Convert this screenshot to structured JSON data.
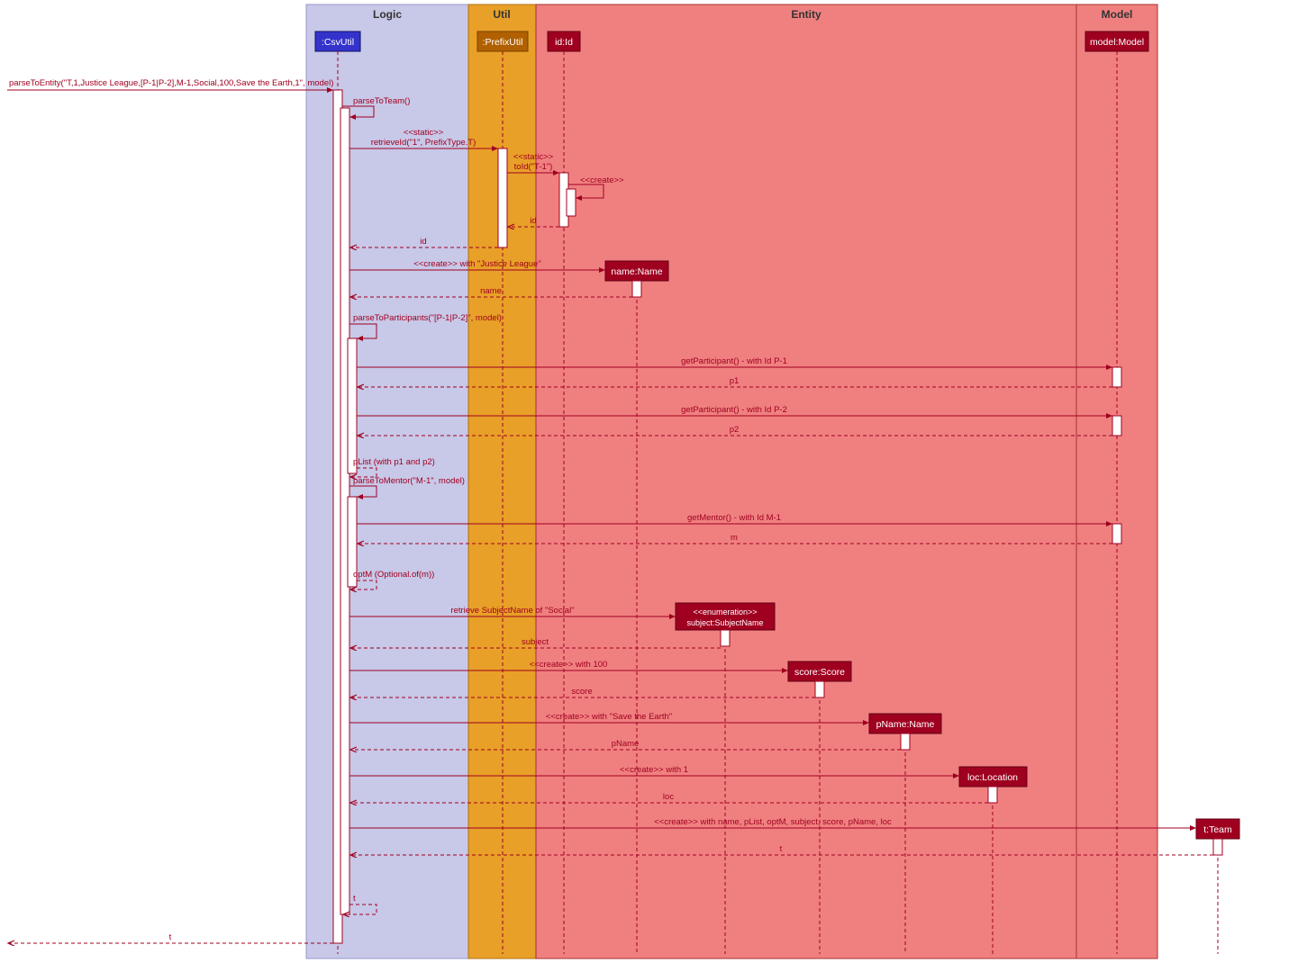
{
  "regions": {
    "logic": "Logic",
    "util": "Util",
    "entity": "Entity",
    "model": "Model"
  },
  "participants": {
    "csvutil": ":CsvUtil",
    "prefixutil": ":PrefixUtil",
    "id": "id:Id",
    "model": "model:Model",
    "name": "name:Name",
    "subject_stereo": "<<enumeration>>",
    "subject": "subject:SubjectName",
    "score": "score:Score",
    "pname": "pName:Name",
    "loc": "loc:Location",
    "team": "t:Team"
  },
  "messages": {
    "m0": "parseToEntity(\"T,1,Justice League,[P-1|P-2],M-1,Social,100,Save the Earth,1\", model)",
    "m1": "parseToTeam()",
    "m2a": "<<static>>",
    "m2b": "retrieveId(\"1\", PrefixType.T)",
    "m3a": "<<static>>",
    "m3b": "toId(\"T-1\")",
    "m4": "<<create>>",
    "m5": "id",
    "m6": "id",
    "m7": "<<create>> with \"Justice League\"",
    "m8": "name",
    "m9": "parseToParticipants(\"[P-1|P-2]\", model)",
    "m10": "getParticipant() - with Id P-1",
    "m11": "p1",
    "m12": "getParticipant() - with Id P-2",
    "m13": "p2",
    "m14": "pList (with p1 and p2)",
    "m15": "parseToMentor(\"M-1\", model)",
    "m16": "getMentor() - with Id M-1",
    "m17": "m",
    "m18": "optM (Optional.of(m))",
    "m19": "retrieve SubjectName of \"Social\"",
    "m20": "subject",
    "m21": "<<create>> with 100",
    "m22": "score",
    "m23": "<<create>> with \"Save the Earth\"",
    "m24": "pName",
    "m25": "<<create>> with 1",
    "m26": "loc",
    "m27": "<<create>> with name, pList, optM, subject, score, pName, loc",
    "m28": "t",
    "m29": "t",
    "m30": "t"
  }
}
